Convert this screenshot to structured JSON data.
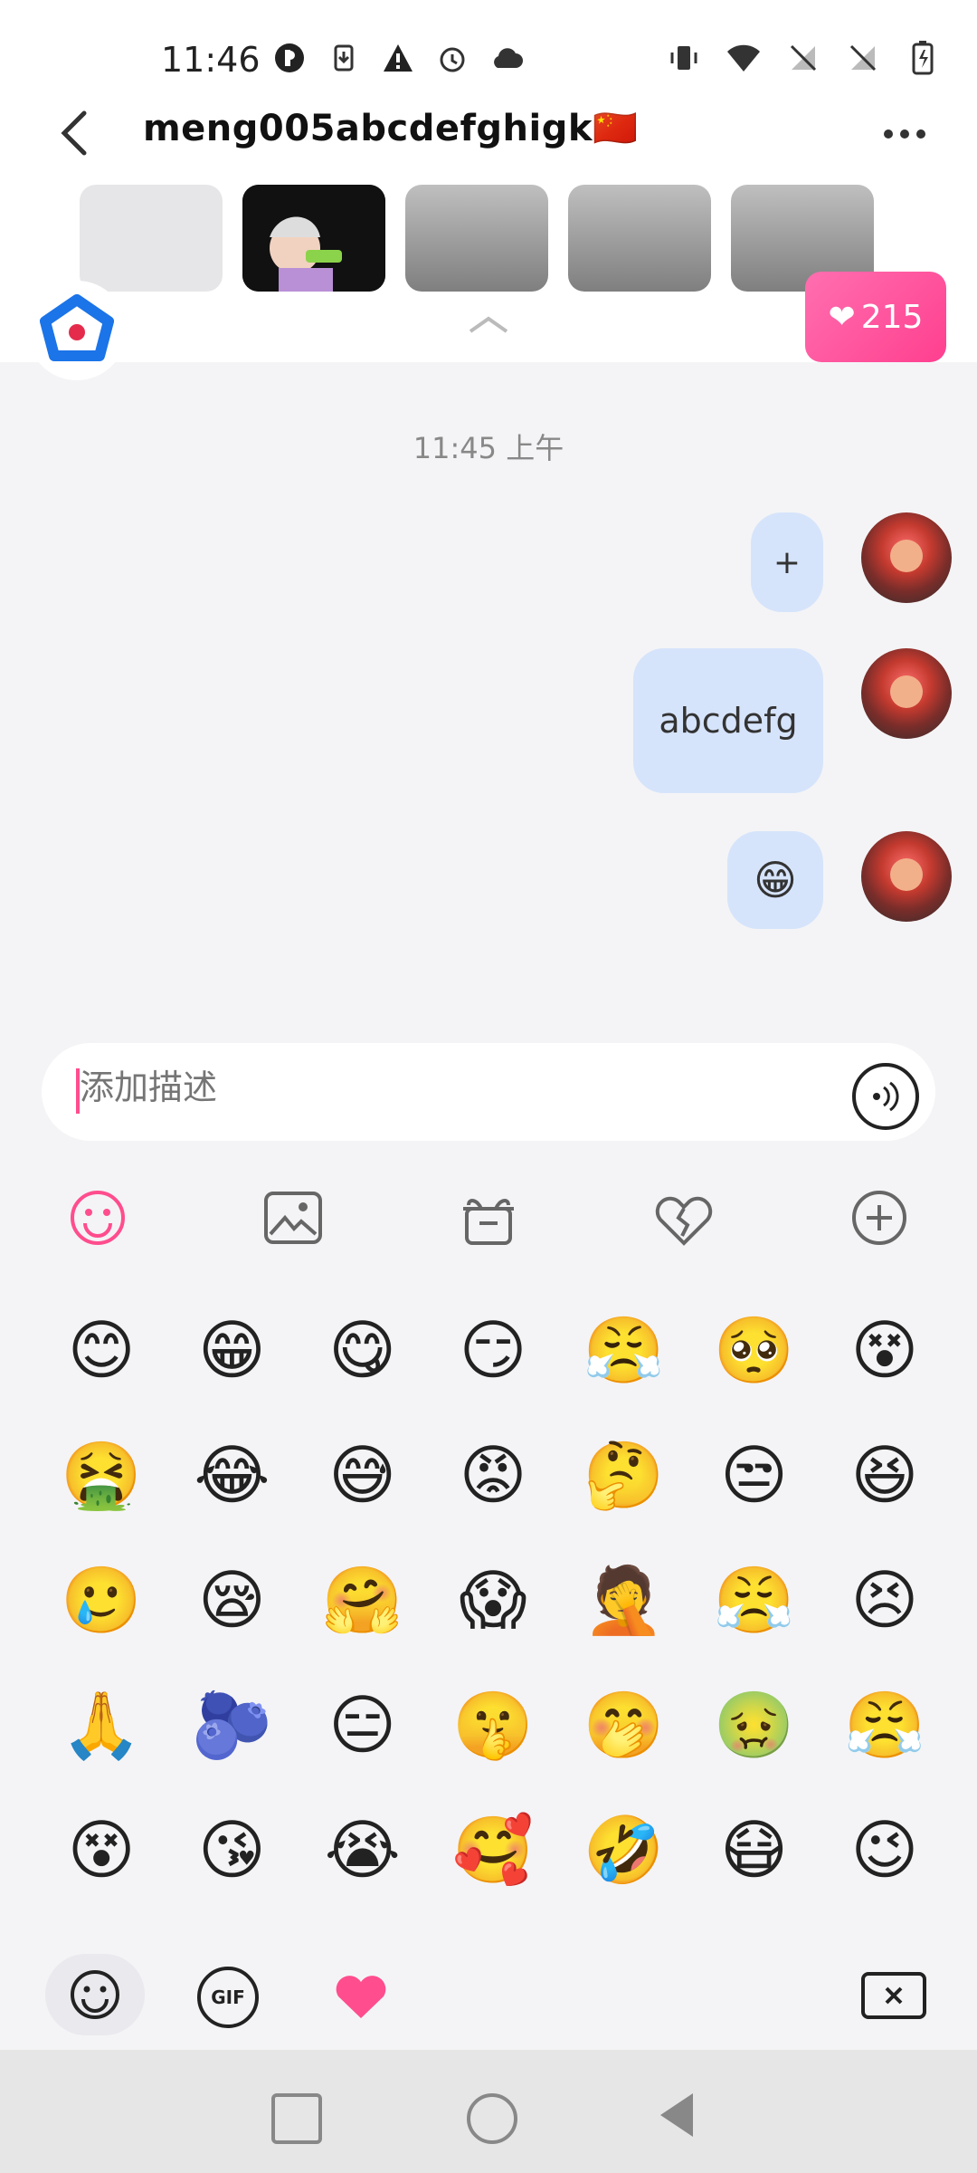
{
  "status_bar": {
    "time": "11:46",
    "left_icons": [
      "p-icon",
      "download-icon",
      "warning-icon",
      "alarm-icon",
      "cloud-icon"
    ],
    "right_icons": [
      "vibrate-icon",
      "wifi-icon",
      "no-signal-icon",
      "no-signal-icon",
      "battery-icon"
    ]
  },
  "header": {
    "title": "meng005abcdefghigk🇨🇳",
    "likes_count": "215"
  },
  "chat": {
    "timestamp": "11:45 上午",
    "messages": [
      {
        "text": "+"
      },
      {
        "text": "abcdefg"
      },
      {
        "text": "😁"
      }
    ]
  },
  "input": {
    "placeholder": "添加描述"
  },
  "emojis": [
    "😊",
    "😁",
    "😋",
    "😏",
    "😤",
    "🥺",
    "😵",
    "🤮",
    "😂",
    "😅",
    "😡",
    "🤔",
    "😒",
    "😆",
    "🥲",
    "😪",
    "🤗",
    "😱",
    "🤦",
    "😤",
    "😣",
    "🙏",
    "🫐",
    "😑",
    "🤫",
    "🤭",
    "🤢",
    "😤",
    "😵",
    "😘",
    "😭",
    "🥰",
    "🤣",
    "😷",
    "😉"
  ],
  "bottom_tools": {
    "gif_label": "GIF"
  },
  "colors": {
    "accent": "#ff4d8d",
    "bubble": "#d6e4fb"
  }
}
